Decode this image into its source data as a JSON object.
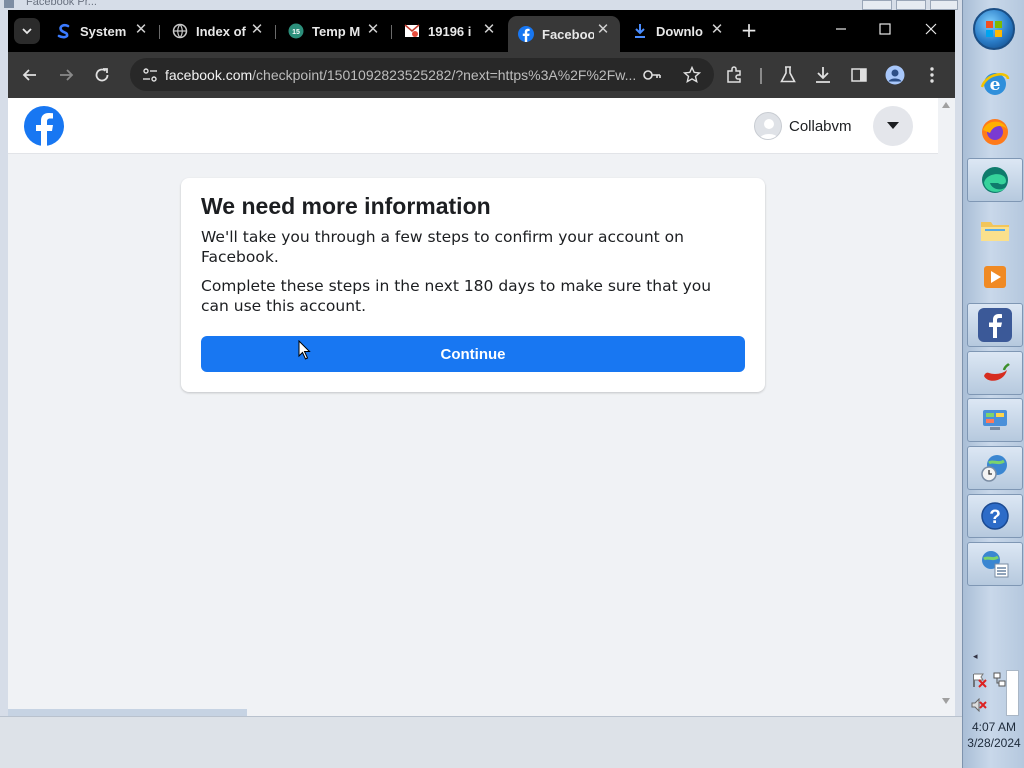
{
  "os": {
    "window_title": "Facebook Pr...",
    "clock_time": "4:07 AM",
    "clock_date": "3/28/2024"
  },
  "browser": {
    "tabs": [
      {
        "label": "System",
        "icon": "s-logo-icon"
      },
      {
        "label": "Index of",
        "icon": "globe-icon"
      },
      {
        "label": "Temp M",
        "icon": "temp-mail-icon"
      },
      {
        "label": "19196 i",
        "icon": "mail-icon"
      },
      {
        "label": "Faceboo",
        "icon": "facebook-icon",
        "active": true
      },
      {
        "label": "Downlo",
        "icon": "download-icon"
      }
    ],
    "url_host": "facebook.com",
    "url_path": "/checkpoint/1501092823525282/?next=https%3A%2F%2Fw..."
  },
  "page": {
    "username": "Collabvm",
    "card": {
      "title": "We need more information",
      "para1": "We'll take you through a few steps to confirm your account on Facebook.",
      "para2": "Complete these steps in the next 180 days to make sure that you can use this account.",
      "continue_label": "Continue"
    }
  },
  "colors": {
    "facebook_blue": "#1877f2",
    "page_bg": "#f0f2f5",
    "browser_dark": "#383838"
  }
}
